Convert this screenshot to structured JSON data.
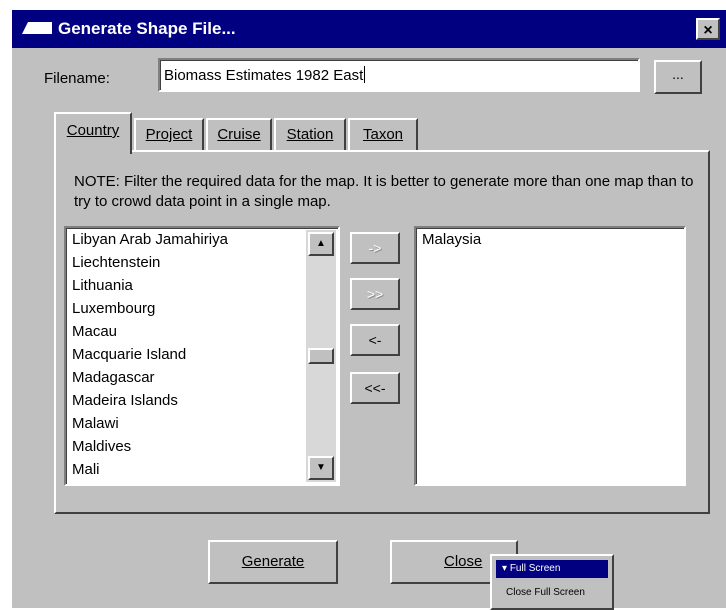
{
  "window": {
    "title": "Generate Shape File...",
    "close_glyph": "×"
  },
  "filename": {
    "label": "Filename:",
    "value": "Biomass Estimates 1982 East",
    "browse_label": "..."
  },
  "tabs": [
    {
      "label": "Country",
      "active": true
    },
    {
      "label": "Project",
      "active": false
    },
    {
      "label": "Cruise",
      "active": false
    },
    {
      "label": "Station",
      "active": false
    },
    {
      "label": "Taxon",
      "active": false
    }
  ],
  "note": "NOTE: Filter the required data for the map. It is better to generate more than one map than to try to crowd data point in a single map.",
  "available_list": [
    "Libyan Arab Jamahiriya",
    "Liechtenstein",
    "Lithuania",
    "Luxembourg",
    "Macau",
    "Macquarie Island",
    "Madagascar",
    "Madeira Islands",
    "Malawi",
    "Maldives",
    "Mali"
  ],
  "selected_list": [
    "Malaysia"
  ],
  "transfer_buttons": {
    "add": "->",
    "add_all": ">>",
    "remove": "<-",
    "remove_all": "<<-"
  },
  "scrollbar": {
    "up_icon": "▲",
    "down_icon": "▼"
  },
  "buttons": {
    "generate": "Generate",
    "close": "Close"
  },
  "popup_menu": {
    "item_full_screen": "Full Screen",
    "item_close_full_screen": "Close Full Screen",
    "indicator": "▾"
  },
  "colors": {
    "titlebar": "#000080",
    "face": "#c0c0c0",
    "highlight": "#ffffff",
    "shadow": "#404040"
  }
}
